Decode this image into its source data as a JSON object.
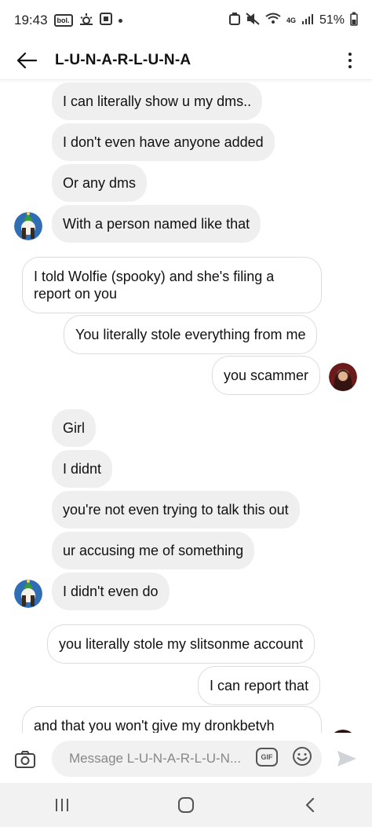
{
  "status_bar": {
    "time": "19:43",
    "box_icon_text": "bol.",
    "battery": "51%",
    "network": "4G"
  },
  "header": {
    "title": "L-U-N-A-R-L-U-N-A"
  },
  "messages": [
    {
      "text": "I can literally show u my dms..",
      "direction": "incoming"
    },
    {
      "text": "I don't even have anyone added",
      "direction": "incoming"
    },
    {
      "text": "Or any dms",
      "direction": "incoming"
    },
    {
      "text": "With a person named like that",
      "direction": "incoming"
    },
    {
      "text": "I told Wolfie (spooky) and she's filing a report on you",
      "direction": "outgoing"
    },
    {
      "text": "You literally stole everything from me",
      "direction": "outgoing"
    },
    {
      "text": "you scammer",
      "direction": "outgoing"
    },
    {
      "text": "Girl",
      "direction": "incoming"
    },
    {
      "text": "I didnt",
      "direction": "incoming"
    },
    {
      "text": "you're not even trying to talk this out",
      "direction": "incoming"
    },
    {
      "text": "ur accusing me of something",
      "direction": "incoming"
    },
    {
      "text": "I didn't even do",
      "direction": "incoming"
    },
    {
      "text": "you literally stole my slitsonme account",
      "direction": "outgoing"
    },
    {
      "text": "I can report that",
      "direction": "outgoing"
    },
    {
      "text": "and that you won't give my dronkbetvh",
      "direction": "outgoing"
    }
  ],
  "composer": {
    "placeholder": "Message L-U-N-A-R-L-U-N...",
    "gif_label": "GIF"
  },
  "colors": {
    "incoming_bubble": "#efefef",
    "outgoing_border": "#dcdcdc",
    "avatar_them": "#2f6db5",
    "avatar_me": "#6b1b1b"
  }
}
